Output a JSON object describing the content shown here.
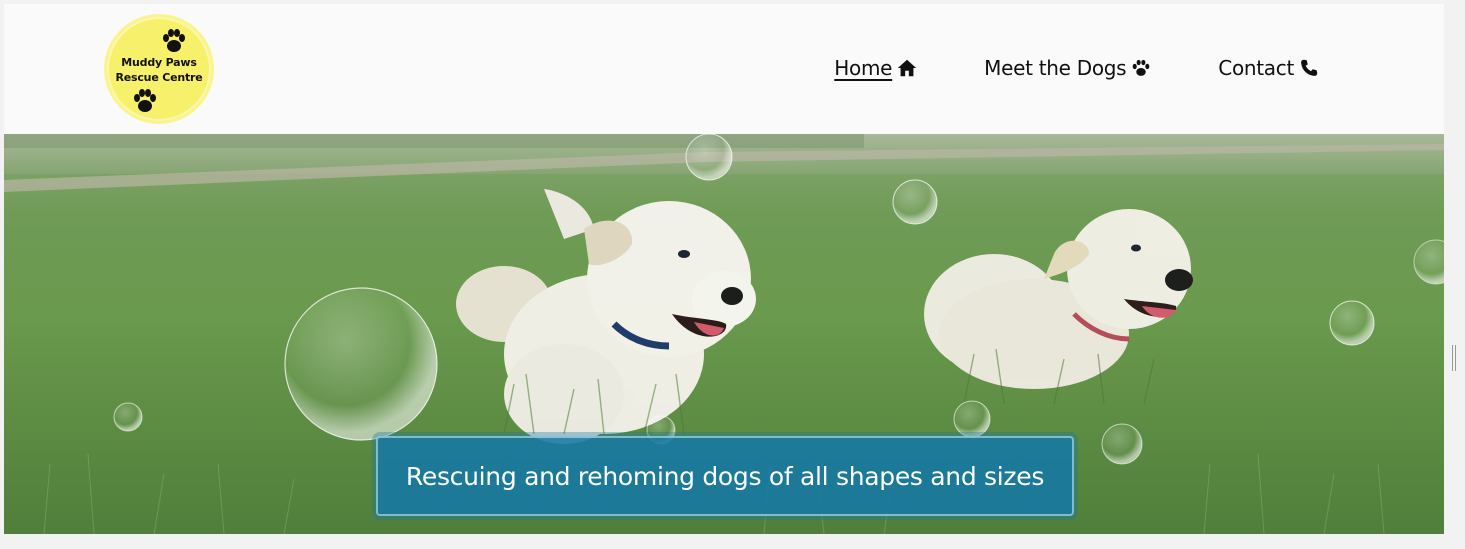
{
  "logo": {
    "line1": "Muddy Paws",
    "line2": "Rescue Centre",
    "icon": "paw-icon",
    "bg_color": "#f7f06a"
  },
  "nav": {
    "items": [
      {
        "label": "Home",
        "icon": "home-icon",
        "active": true
      },
      {
        "label": "Meet the Dogs",
        "icon": "paw-icon",
        "active": false
      },
      {
        "label": "Contact",
        "icon": "phone-icon",
        "active": false
      }
    ]
  },
  "hero": {
    "caption": "Rescuing and rehoming dogs of all shapes and sizes",
    "caption_bg": "#1478a5"
  }
}
